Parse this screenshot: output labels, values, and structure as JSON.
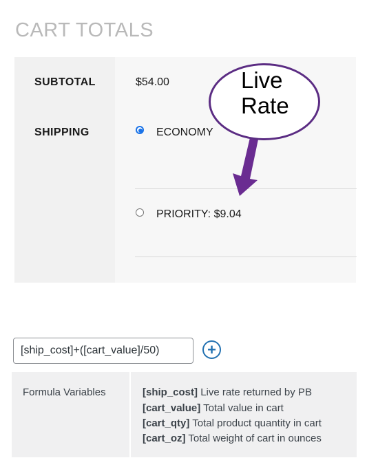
{
  "cart_totals": {
    "title": "CART TOTALS",
    "subtotal_label": "SUBTOTAL",
    "subtotal_value": "$54.00",
    "shipping_label": "SHIPPING",
    "options": [
      {
        "label": "ECONOMY",
        "selected": true
      },
      {
        "label": "PRIORITY: $9.04",
        "selected": false
      }
    ]
  },
  "annotation": {
    "callout_text": "Live Rate",
    "arrow_color": "#6a2c91"
  },
  "formula": {
    "input_value": "[ship_cost]+([cart_value]/50)",
    "add_icon": "plus-circle-icon"
  },
  "variables": {
    "label": "Formula Variables",
    "items": [
      {
        "name": "[ship_cost]",
        "desc": "Live rate returned by PB"
      },
      {
        "name": "[cart_value]",
        "desc": "Total value in cart"
      },
      {
        "name": "[cart_qty]",
        "desc": "Total product quantity in cart"
      },
      {
        "name": "[cart_oz]",
        "desc": "Total weight of cart in ounces"
      }
    ]
  },
  "colors": {
    "radio_selected": "#1a73e8",
    "callout_border": "#5b2c83",
    "add_button": "#2271b1"
  }
}
